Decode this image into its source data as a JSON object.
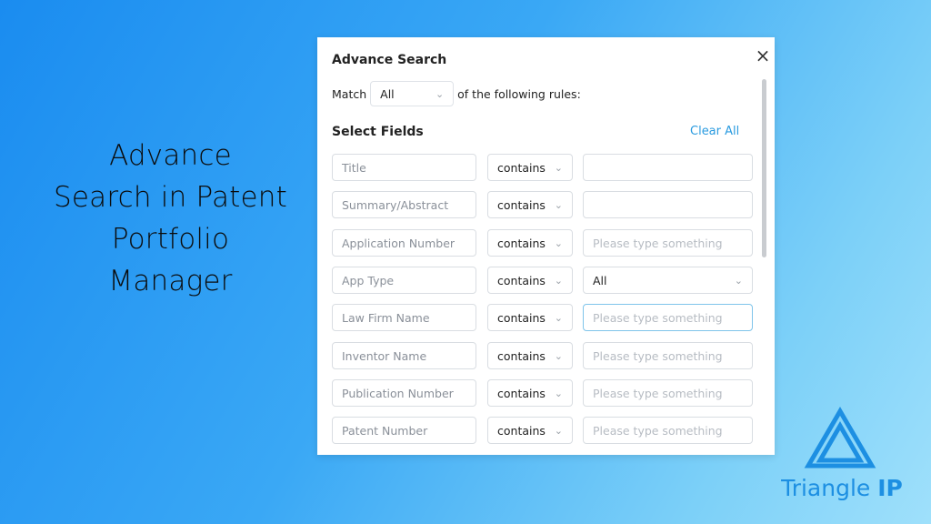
{
  "headline": [
    "Advance",
    "Search in Patent",
    "Portfolio",
    "Manager"
  ],
  "dialog": {
    "title": "Advance Search",
    "close_icon": "×",
    "match_label": "Match",
    "match_value": "All",
    "match_suffix": "of the following rules:",
    "select_fields_label": "Select Fields",
    "clear_all_label": "Clear All",
    "rows": [
      {
        "field": "Title",
        "operator": "contains",
        "value": "",
        "value_type": "input"
      },
      {
        "field": "Summary/Abstract",
        "operator": "contains",
        "value": "",
        "value_type": "input"
      },
      {
        "field": "Application Number",
        "operator": "contains",
        "value": "Please type something",
        "value_type": "placeholder"
      },
      {
        "field": "App Type",
        "operator": "contains",
        "value": "All",
        "value_type": "select"
      },
      {
        "field": "Law Firm Name",
        "operator": "contains",
        "value": "Please type something",
        "value_type": "placeholder"
      },
      {
        "field": "Inventor Name",
        "operator": "contains",
        "value": "Please type something",
        "value_type": "placeholder"
      },
      {
        "field": "Publication Number",
        "operator": "contains",
        "value": "Please type something",
        "value_type": "placeholder"
      },
      {
        "field": "Patent Number",
        "operator": "contains",
        "value": "Please type something",
        "value_type": "placeholder"
      }
    ]
  },
  "logo": {
    "text_regular": "Triangle",
    "text_bold": "IP",
    "color": "#1d8fe2"
  },
  "colors": {
    "accent": "#2a9be0",
    "bg_start": "#1a8cf0",
    "bg_end": "#9fe0fb"
  }
}
